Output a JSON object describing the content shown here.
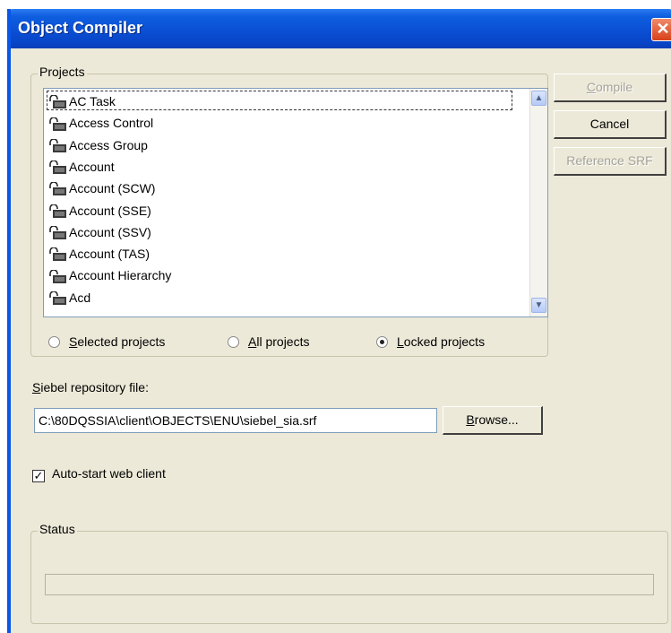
{
  "window": {
    "title": "Object Compiler",
    "close_glyph": "✕"
  },
  "projects": {
    "legend": "Projects",
    "items": [
      "AC Task",
      "Access Control",
      "Access Group",
      "Account",
      "Account (SCW)",
      "Account (SSE)",
      "Account (SSV)",
      "Account (TAS)",
      "Account Hierarchy",
      "Acd"
    ],
    "radios": [
      {
        "first": "S",
        "rest": "elected projects",
        "selected": false
      },
      {
        "first": "A",
        "rest": "ll projects",
        "selected": false
      },
      {
        "first": "L",
        "rest": "ocked projects",
        "selected": true
      }
    ]
  },
  "buttons": {
    "compile": {
      "first": "C",
      "rest": "ompile",
      "enabled": false
    },
    "cancel": {
      "label": "Cancel",
      "enabled": true
    },
    "reference": {
      "label": "Reference SRF",
      "enabled": false
    }
  },
  "repository": {
    "label_first": "S",
    "label_rest": "iebel repository file:",
    "value": "C:\\80DQSSIA\\client\\OBJECTS\\ENU\\siebel_sia.srf",
    "browse_first": "B",
    "browse_rest": "rowse..."
  },
  "autostart": {
    "label": "Auto-start web client",
    "checked": true
  },
  "status": {
    "legend": "Status",
    "progress": 0
  },
  "icons": {
    "item": "lock-icon",
    "scroll_up": "chevron-up-icon",
    "scroll_down": "chevron-down-icon"
  }
}
